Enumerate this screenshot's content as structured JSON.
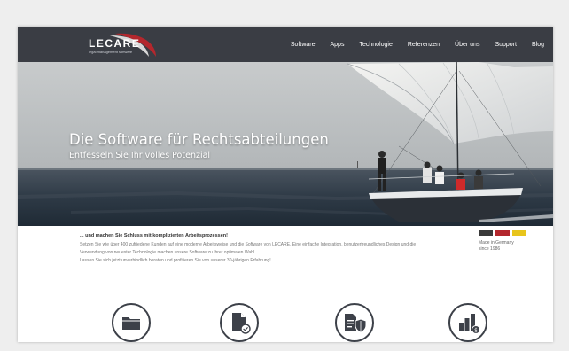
{
  "brand": {
    "name": "LECARE",
    "tagline": "legal management software"
  },
  "nav": {
    "items": [
      {
        "label": "Software"
      },
      {
        "label": "Apps"
      },
      {
        "label": "Technologie"
      },
      {
        "label": "Referenzen"
      },
      {
        "label": "Über uns"
      },
      {
        "label": "Support"
      },
      {
        "label": "Blog"
      }
    ]
  },
  "hero": {
    "title": "Die Software für Rechtsabteilungen",
    "subtitle": "Entfesseln Sie Ihr volles Potenzial"
  },
  "intro": {
    "heading": "... und machen Sie Schluss mit komplizierten Arbeitsprozessen!",
    "paragraph1": "Setzen Sie wie über 400 zufriedene Kunden auf eine moderne Arbeitsweise und die Software von LECARE. Eine einfache Integration, benutzerfreundliches Design und die Verwendung von neuester Technologie machen unsere Software zu Ihrer optimalen Wahl.",
    "paragraph2": "Lassen Sie sich jetzt unverbindlich beraten und profitieren Sie von unserer 30-jährigen Erfahrung!"
  },
  "made_in_germany": {
    "line1": "Made in Germany",
    "line2": "since 1986",
    "flag_colors": [
      "#3a3a3a",
      "#b3272d",
      "#e8c51c"
    ]
  },
  "features": [
    {
      "icon": "folder-icon"
    },
    {
      "icon": "document-check-icon"
    },
    {
      "icon": "document-shield-icon"
    },
    {
      "icon": "bar-chart-coin-icon"
    }
  ],
  "colors": {
    "navbar": "#3a3d44",
    "accent_red": "#b3272d",
    "icon_dark": "#3d4149"
  }
}
